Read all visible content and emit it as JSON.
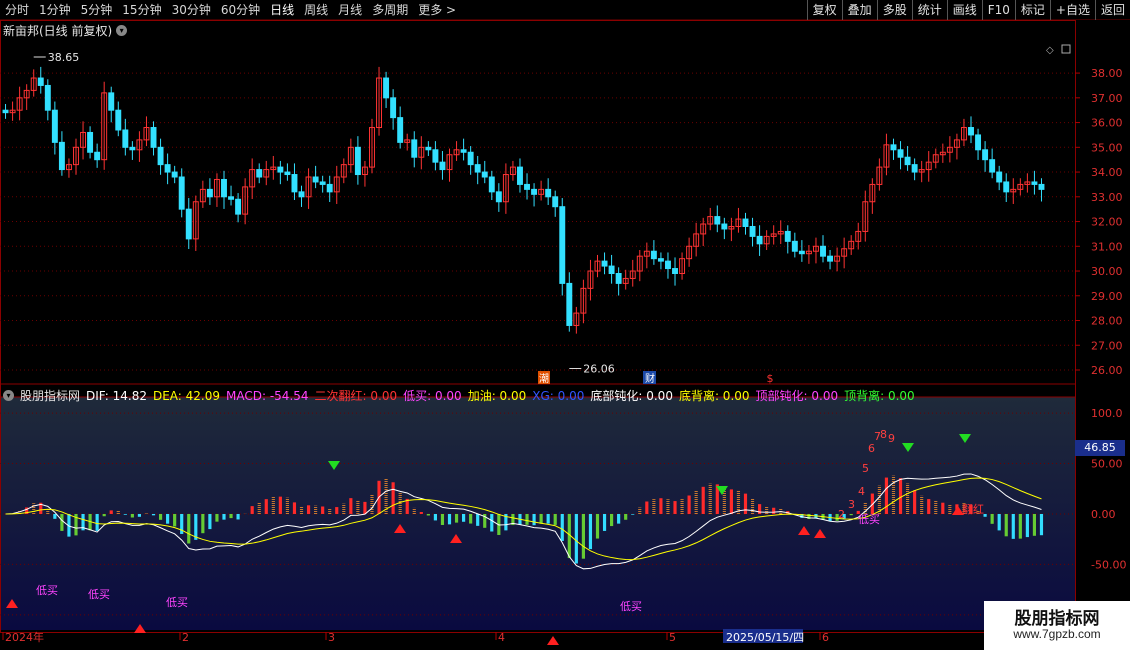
{
  "toolbar": {
    "timeframes": [
      "分时",
      "1分钟",
      "5分钟",
      "15分钟",
      "30分钟",
      "60分钟",
      "日线",
      "周线",
      "月线",
      "多周期",
      "更多 >"
    ],
    "active_timeframe": "日线",
    "actions": [
      "复权",
      "叠加",
      "多股",
      "统计",
      "画线",
      "F10",
      "标记",
      "+自选",
      "返回"
    ]
  },
  "stock": {
    "title": "新亩邦(日线 前复权)",
    "high_marker": "38.65",
    "low_marker": "26.06"
  },
  "indicator": {
    "name": "股朋指标网",
    "values": [
      {
        "label": "DIF: 14.82",
        "color": "#ffffff"
      },
      {
        "label": "DEA: 42.09",
        "color": "#ffff00"
      },
      {
        "label": "MACD: -54.54",
        "color": "#ff44ff"
      },
      {
        "label": "二次翻红: 0.00",
        "color": "#ff3333"
      },
      {
        "label": "低买: 0.00",
        "color": "#ff44ff"
      },
      {
        "label": "加油: 0.00",
        "color": "#ffff00"
      },
      {
        "label": "XG: 0.00",
        "color": "#3355ff"
      },
      {
        "label": "底部钝化: 0.00",
        "color": "#ffffff"
      },
      {
        "label": "底背离: 0.00",
        "color": "#ffff00"
      },
      {
        "label": "顶部钝化: 0.00",
        "color": "#ff44ff"
      },
      {
        "label": "顶背离: 0.00",
        "color": "#33ff33"
      }
    ],
    "current_value": "46.85",
    "signal_label": "低买",
    "redflip_label": "翻红"
  },
  "price_axis": [
    "38.00",
    "37.00",
    "36.00",
    "35.00",
    "34.00",
    "33.00",
    "32.00",
    "31.00",
    "30.00",
    "29.00",
    "28.00",
    "27.00",
    "26.00"
  ],
  "ind_axis": [
    "100.0",
    "50.00",
    "0.00",
    "-50.00",
    "-100.0"
  ],
  "date_axis": [
    {
      "label": "2024年"
    },
    {
      "label": "2"
    },
    {
      "label": "3"
    },
    {
      "label": "4"
    },
    {
      "label": "5"
    },
    {
      "label": "2025/05/15/四"
    },
    {
      "label": "6"
    }
  ],
  "markers": {
    "chao": "潮",
    "cai": "财",
    "dollar": "$"
  },
  "counts": [
    "2",
    "3",
    "4",
    "5",
    "6",
    "7",
    "8",
    "9"
  ],
  "watermark": {
    "title": "股朋指标网",
    "url": "www.7gpzb.com"
  },
  "colors": {
    "up": "#ff3333",
    "down": "#33e0ff",
    "dif": "#ffffff",
    "dea": "#ffff00"
  },
  "chart_data": {
    "type": "candlestick",
    "closes": [
      36.4,
      36.5,
      37.0,
      37.3,
      37.8,
      37.5,
      36.5,
      35.2,
      34.1,
      34.3,
      35.0,
      35.6,
      34.8,
      34.5,
      37.2,
      36.5,
      35.7,
      35.0,
      34.9,
      35.3,
      35.8,
      35.0,
      34.3,
      34.0,
      33.8,
      32.5,
      31.3,
      32.8,
      33.3,
      33.0,
      33.7,
      33.0,
      32.9,
      32.3,
      33.4,
      34.1,
      33.8,
      34.1,
      34.2,
      34.0,
      33.9,
      33.2,
      33.0,
      33.8,
      33.6,
      33.5,
      33.2,
      33.8,
      34.3,
      35.0,
      33.9,
      34.2,
      35.8,
      37.8,
      37.0,
      36.2,
      35.2,
      35.3,
      34.6,
      35.0,
      34.9,
      34.4,
      34.1,
      34.7,
      34.9,
      34.8,
      34.3,
      34.0,
      33.8,
      33.2,
      32.8,
      33.9,
      34.2,
      33.5,
      33.3,
      33.1,
      33.3,
      33.0,
      32.6,
      29.5,
      27.8,
      28.3,
      29.3,
      30.0,
      30.4,
      30.2,
      29.9,
      29.5,
      29.7,
      30.0,
      30.6,
      30.8,
      30.5,
      30.4,
      30.1,
      29.9,
      30.5,
      31.0,
      31.5,
      31.9,
      32.2,
      31.9,
      31.7,
      31.8,
      32.1,
      31.8,
      31.4,
      31.1,
      31.4,
      31.5,
      31.6,
      31.2,
      30.8,
      30.7,
      30.8,
      31.0,
      30.6,
      30.4,
      30.6,
      30.9,
      31.2,
      31.6,
      32.8,
      33.5,
      34.2,
      35.1,
      34.9,
      34.6,
      34.3,
      34.0,
      34.1,
      34.4,
      34.7,
      34.8,
      35.0,
      35.3,
      35.8,
      35.5,
      34.9,
      34.5,
      34.0,
      33.6,
      33.2,
      33.3,
      33.5,
      33.6,
      33.5,
      33.3
    ],
    "price_range": [
      26.0,
      38.65
    ],
    "ind_range": [
      -115,
      110
    ]
  }
}
